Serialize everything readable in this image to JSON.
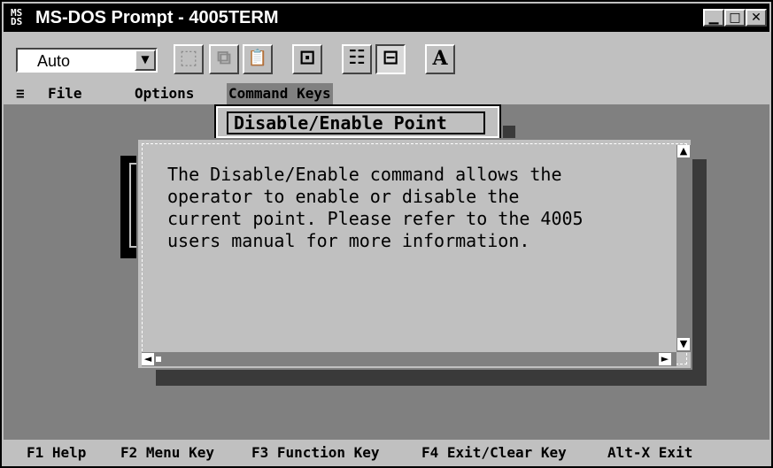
{
  "window": {
    "title": "MS-DOS Prompt - 4005TERM",
    "icon": "ms-dos-icon",
    "controls": {
      "minimize_icon": "minimize-icon",
      "maximize_icon": "maximize-icon",
      "close_icon": "close-icon",
      "minimize": "▁",
      "maximize": "□",
      "close": "✕"
    }
  },
  "toolbar": {
    "font_size_value": "Auto",
    "dropdown_arrow": "▼",
    "tools": [
      {
        "icon": "mark-icon",
        "glyph": "⬚"
      },
      {
        "icon": "copy-icon",
        "glyph": "⧉"
      },
      {
        "icon": "paste-icon",
        "glyph": "📋"
      },
      {
        "icon": "fullscreen-icon",
        "glyph": "⊡"
      },
      {
        "icon": "properties-icon",
        "glyph": "☷"
      },
      {
        "icon": "background-icon",
        "glyph": "⊟"
      },
      {
        "icon": "font-icon",
        "glyph": "A"
      }
    ]
  },
  "dos": {
    "menu": {
      "system_glyph": "≡",
      "items": [
        "File",
        "Options",
        "Command Keys"
      ]
    },
    "dropdown": {
      "item": "Disable/Enable Point"
    },
    "dialog": {
      "lines": [
        "The Disable/Enable command allows the",
        "operator to enable or disable the",
        "current point. Please refer to the 4005",
        "users manual for more information."
      ],
      "scroll_up": "▲",
      "scroll_down": "▼",
      "scroll_left": "◄",
      "scroll_right": "►"
    },
    "status": [
      "F1 Help",
      "F2 Menu Key",
      "F3 Function Key",
      "F4 Exit/Clear Key",
      "Alt-X Exit"
    ]
  },
  "colors": {
    "title_bar": "#000000",
    "dos_background": "#808080",
    "dialog_background": "#c0c0c0"
  }
}
